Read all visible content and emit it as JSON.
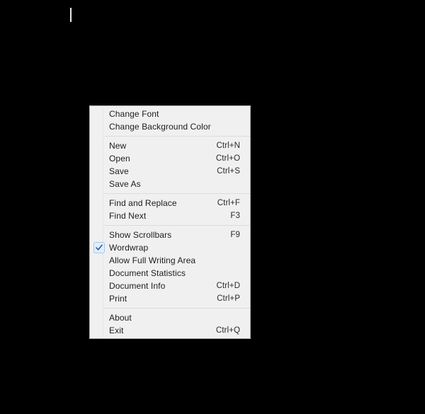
{
  "editor": {
    "background_color": "#000000",
    "caret_color": "#e8e8e8",
    "caret_visible": true
  },
  "context_menu": {
    "background_color": "#f0f0f0",
    "border_color": "#9a9a9a",
    "text_color": "#1c1c1c",
    "check_color": "#2b57a8",
    "check_box_fill": "#e2eefb",
    "check_box_border": "#a8c8e8",
    "sections": [
      {
        "items": [
          {
            "label": "Change Font",
            "shortcut": "",
            "checked": false
          },
          {
            "label": "Change Background Color",
            "shortcut": "",
            "checked": false
          }
        ]
      },
      {
        "items": [
          {
            "label": "New",
            "shortcut": "Ctrl+N",
            "checked": false
          },
          {
            "label": "Open",
            "shortcut": "Ctrl+O",
            "checked": false
          },
          {
            "label": "Save",
            "shortcut": "Ctrl+S",
            "checked": false
          },
          {
            "label": "Save As",
            "shortcut": "",
            "checked": false
          }
        ]
      },
      {
        "items": [
          {
            "label": "Find and Replace",
            "shortcut": "Ctrl+F",
            "checked": false
          },
          {
            "label": "Find Next",
            "shortcut": "F3",
            "checked": false
          }
        ]
      },
      {
        "items": [
          {
            "label": "Show Scrollbars",
            "shortcut": "F9",
            "checked": false
          },
          {
            "label": "Wordwrap",
            "shortcut": "",
            "checked": true
          },
          {
            "label": "Allow Full Writing Area",
            "shortcut": "",
            "checked": false
          },
          {
            "label": "Document Statistics",
            "shortcut": "",
            "checked": false
          },
          {
            "label": "Document Info",
            "shortcut": "Ctrl+D",
            "checked": false
          },
          {
            "label": "Print",
            "shortcut": "Ctrl+P",
            "checked": false
          }
        ]
      },
      {
        "items": [
          {
            "label": "About",
            "shortcut": "",
            "checked": false
          },
          {
            "label": "Exit",
            "shortcut": "Ctrl+Q",
            "checked": false
          }
        ]
      }
    ]
  }
}
